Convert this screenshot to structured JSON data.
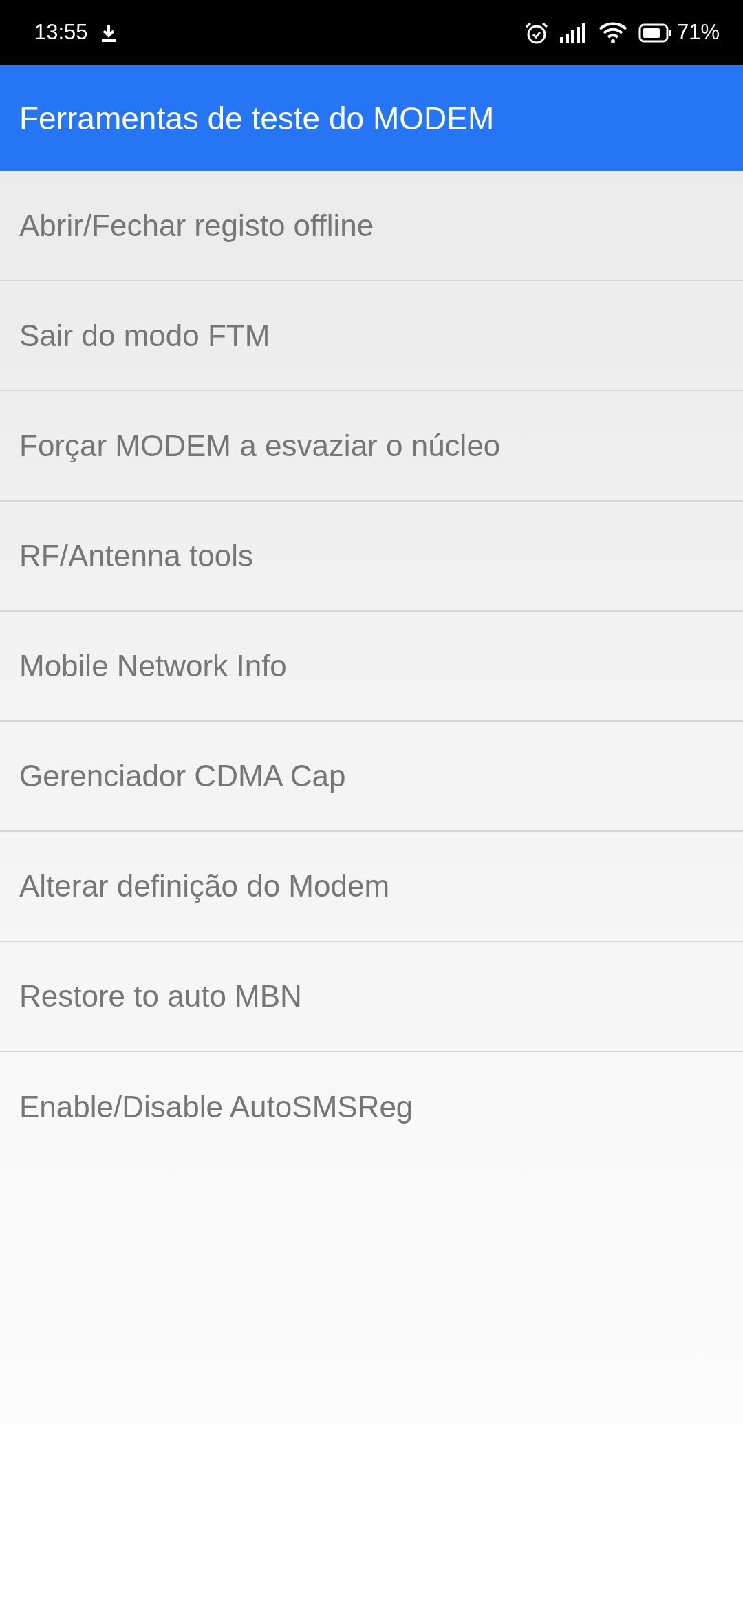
{
  "status_bar": {
    "time": "13:55",
    "battery": "71%"
  },
  "app_bar": {
    "title": "Ferramentas de teste do MODEM"
  },
  "menu_items": [
    {
      "label": "Abrir/Fechar registo offline"
    },
    {
      "label": "Sair do modo FTM"
    },
    {
      "label": "Forçar MODEM a esvaziar o núcleo"
    },
    {
      "label": "RF/Antenna tools"
    },
    {
      "label": "Mobile Network Info"
    },
    {
      "label": "Gerenciador CDMA Cap"
    },
    {
      "label": "Alterar definição do Modem"
    },
    {
      "label": "Restore to auto MBN"
    },
    {
      "label": "Enable/Disable AutoSMSReg"
    }
  ]
}
